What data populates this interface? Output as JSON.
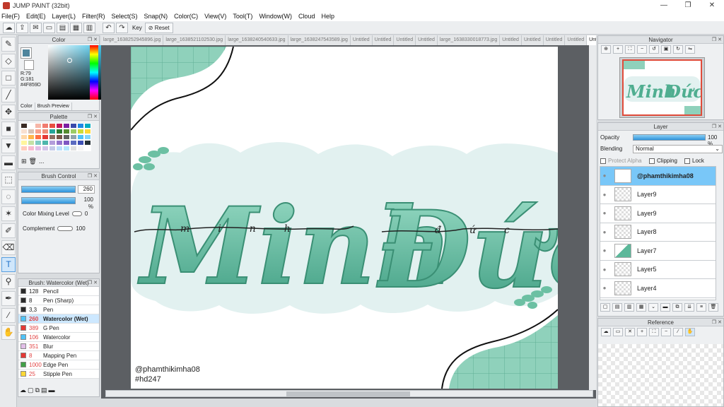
{
  "window": {
    "title": "JUMP PAINT (32bit)",
    "controls": [
      "—",
      "❐",
      "✕"
    ]
  },
  "menu": [
    "File(F)",
    "Edit(E)",
    "Layer(L)",
    "Filter(R)",
    "Select(S)",
    "Snap(N)",
    "Color(C)",
    "View(V)",
    "Tool(T)",
    "Window(W)",
    "Cloud",
    "Help"
  ],
  "toolbar": {
    "key_label": "Key",
    "reset_label": "Reset"
  },
  "color_panel": {
    "title": "Color",
    "r": "R:79",
    "g": "G:181",
    "hex": "#4F859D",
    "tabs": [
      "Color",
      "Brush Preview"
    ],
    "current": "#4f859d"
  },
  "palette_panel": {
    "title": "Palette",
    "more": "...",
    "colors": [
      "#3a2b25",
      "#ffffff",
      "#f6b6a8",
      "#f07b6f",
      "#e84e40",
      "#c2185b",
      "#7b1fa2",
      "#3949ab",
      "#1e88e5",
      "#00acc1",
      "#f8e0d0",
      "#d9c2b4",
      "#f9a38e",
      "#ef8f7a",
      "#26a69a",
      "#2e7d32",
      "#558b2f",
      "#9ccc65",
      "#cddc39",
      "#fdd835",
      "#ffd8a8",
      "#ffb74d",
      "#ff7043",
      "#e53935",
      "#8d6e63",
      "#795548",
      "#616161",
      "#90a4ae",
      "#4fc3f7",
      "#81d4fa",
      "#fff59d",
      "#c5e1a5",
      "#80cbc4",
      "#4db6ac",
      "#b39ddb",
      "#9575cd",
      "#7e57c2",
      "#5c6bc0",
      "#3f51b5",
      "#263238",
      "#ffccbc",
      "#f8bbd0",
      "#e1bee7",
      "#d1c4e9",
      "#c5cae9",
      "#bbdefb",
      "#b3e5fc",
      "#e0e0e0",
      "#f5f5f5",
      "#ffffff"
    ]
  },
  "brush_control": {
    "title": "Brush Control",
    "size": "260",
    "opacity": "100 %",
    "color_mixing_label": "Color Mixing Level",
    "color_mixing_value": "0",
    "complement_label": "Complement",
    "complement_value": "100"
  },
  "brush_list": {
    "title": "Brush: Watercolor (Wet)",
    "items": [
      {
        "size": "128",
        "name": "Pencil",
        "color": "#2b2b2b"
      },
      {
        "size": "8",
        "name": "Pen (Sharp)",
        "color": "#2b2b2b"
      },
      {
        "size": "3,3",
        "name": "Pen",
        "color": "#2b2b2b"
      },
      {
        "size": "260",
        "name": "Watercolor (Wet)",
        "color": "#4fc3f7",
        "selected": true
      },
      {
        "size": "389",
        "name": "G Pen",
        "color": "#e53935"
      },
      {
        "size": "106",
        "name": "Watercolor",
        "color": "#4fc3f7"
      },
      {
        "size": "351",
        "name": "Blur",
        "color": "#e1bee7"
      },
      {
        "size": "8",
        "name": "Mapping Pen",
        "color": "#e53935"
      },
      {
        "size": "1000",
        "name": "Edge Pen",
        "color": "#43a047"
      },
      {
        "size": "25",
        "name": "Stipple Pen",
        "color": "#fdd835"
      }
    ]
  },
  "doc_tabs": [
    "large_1638252945896.jpg",
    "large_1638521102530.jpg",
    "large_1638240540633.jpg",
    "large_1638247543589.jpg",
    "Untitled",
    "Untitled",
    "Untitled",
    "Untitled",
    "large_1638330018773.jpg",
    "Untitled",
    "Untitled",
    "Untitled",
    "Untitled",
    "Untitled"
  ],
  "artwork": {
    "title_word_1": "Minh",
    "title_word_2": "Đức",
    "script_1": "minh",
    "script_2": "đức",
    "credit_handle": "@phamthikimha08",
    "credit_tag": "#hd247",
    "accent": "#5cb89a",
    "light": "#e2f1f0"
  },
  "navigator": {
    "title": "Navigator"
  },
  "layer_panel": {
    "title": "Layer",
    "opacity_label": "Opacity",
    "opacity_value": "100 %",
    "blending_label": "Blending",
    "blending_value": "Normal",
    "protect_alpha": "Protect Alpha",
    "clipping": "Clipping",
    "lock": "Lock",
    "layers": [
      "@phamthikimha08",
      "Layer9",
      "Layer9",
      "Layer8",
      "Layer7",
      "Layer5",
      "Layer4"
    ]
  },
  "reference": {
    "title": "Reference"
  }
}
